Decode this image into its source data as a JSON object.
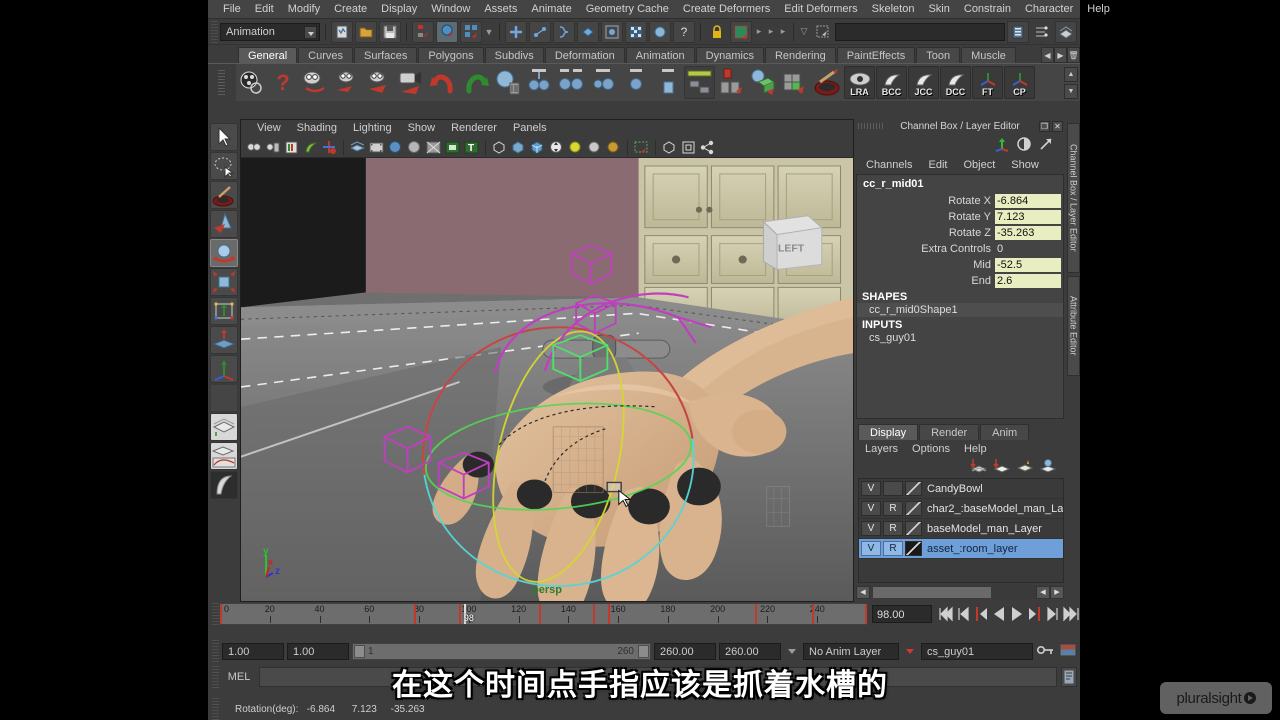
{
  "menubar": {
    "items": [
      "File",
      "Edit",
      "Modify",
      "Create",
      "Display",
      "Window",
      "Assets",
      "Animate",
      "Geometry Cache",
      "Create Deformers",
      "Edit Deformers",
      "Skeleton",
      "Skin",
      "Constrain",
      "Character",
      "Help"
    ]
  },
  "statusline": {
    "mode": "Animation",
    "search_placeholder": ""
  },
  "shelf": {
    "tabs": [
      "General",
      "Curves",
      "Surfaces",
      "Polygons",
      "Subdivs",
      "Deformation",
      "Animation",
      "Dynamics",
      "Rendering",
      "PaintEffects",
      "Toon",
      "Muscle"
    ],
    "selected_tab": "General",
    "text_buttons": [
      "LRA",
      "BCC",
      "JCC",
      "DCC",
      "FT",
      "CP"
    ]
  },
  "viewport": {
    "menus": [
      "View",
      "Shading",
      "Lighting",
      "Show",
      "Renderer",
      "Panels"
    ],
    "camera_label": "persp",
    "axis": {
      "x": "x",
      "y": "y",
      "z": "z"
    },
    "scene_label": "LEFT"
  },
  "channelbox": {
    "title": "Channel Box / Layer Editor",
    "menus": [
      "Channels",
      "Edit",
      "Object",
      "Show"
    ],
    "object_name": "cc_r_mid01",
    "attributes": [
      {
        "label": "Rotate X",
        "value": "-6.864",
        "editable": true
      },
      {
        "label": "Rotate Y",
        "value": "7.123",
        "editable": true
      },
      {
        "label": "Rotate Z",
        "value": "-35.263",
        "editable": true
      },
      {
        "label": "Extra Controls",
        "value": "0",
        "editable": false
      },
      {
        "label": "Mid",
        "value": "-52.5",
        "editable": true
      },
      {
        "label": "End",
        "value": "2.6",
        "editable": true
      }
    ],
    "sections": [
      {
        "header": "SHAPES",
        "items": [
          "cc_r_mid0Shape1"
        ]
      },
      {
        "header": "INPUTS",
        "items": [
          "cs_guy01"
        ]
      }
    ]
  },
  "layereditor": {
    "tabs": [
      "Display",
      "Render",
      "Anim"
    ],
    "selected_tab": "Display",
    "menus": [
      "Layers",
      "Options",
      "Help"
    ],
    "layers": [
      {
        "v": "V",
        "r": "",
        "name": "CandyBowl",
        "selected": false
      },
      {
        "v": "V",
        "r": "R",
        "name": "char2_:baseModel_man_La",
        "selected": false
      },
      {
        "v": "V",
        "r": "R",
        "name": "baseModel_man_Layer",
        "selected": false
      },
      {
        "v": "V",
        "r": "R",
        "name": "asset_:room_layer",
        "selected": true
      }
    ]
  },
  "sidetabs": [
    "Channel Box / Layer Editor",
    "Attribute Editor"
  ],
  "timeline": {
    "ticks": [
      0,
      20,
      40,
      60,
      80,
      100,
      120,
      140,
      160,
      180,
      200,
      220,
      240
    ],
    "start": 0,
    "end": 260,
    "current_frame": "98",
    "current_frame_field": "98.00",
    "keys": [
      0,
      78,
      96,
      128,
      150,
      156,
      215,
      238,
      259
    ]
  },
  "rangeslider": {
    "anim_start": "1.00",
    "playback_start": "1.00",
    "range_left": "1",
    "range_right": "260",
    "playback_end": "260.00",
    "anim_end": "260.00",
    "anim_layer": "No Anim Layer",
    "character_set": "cs_guy01"
  },
  "command": {
    "mel_label": "MEL",
    "mel_value": ""
  },
  "status": {
    "text": "Rotation(deg):   -6.864      7.123     -35.263"
  },
  "subtitle": {
    "text": "在这个时间点手指应该是抓着水槽的"
  },
  "watermark": {
    "text": "pluralsight"
  },
  "colors": {
    "accent_selected": "#6f9fd8",
    "field_value": "#e8eec0",
    "keyframe": "#c0392b",
    "camera_label": "#2f7d32"
  }
}
